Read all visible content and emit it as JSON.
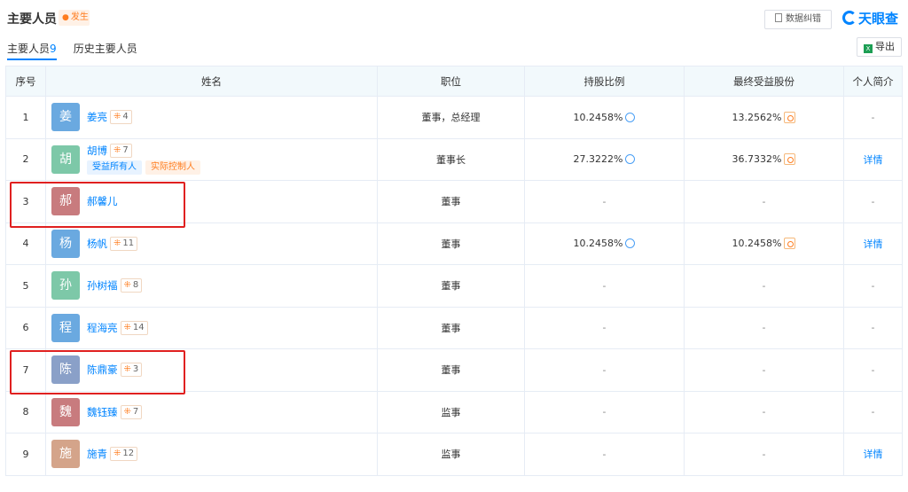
{
  "header": {
    "title": "主要人员",
    "follow_label": "发生",
    "correct_label": "数据纠错",
    "logo_text": "天眼查"
  },
  "tabs": [
    {
      "label": "主要人员",
      "count": "9"
    },
    {
      "label": "历史主要人员",
      "count": ""
    }
  ],
  "export_label": "导出",
  "columns": [
    "序号",
    "姓名",
    "职位",
    "持股比例",
    "最终受益股份",
    "个人简介"
  ],
  "rows": [
    {
      "no": "1",
      "avatar": "姜",
      "color": "#6aa9e0",
      "name": "姜亮",
      "relations": "4",
      "tags": [],
      "position": "董事，总经理",
      "share": "10.2458%",
      "benefit": "13.2562%",
      "intro": "-"
    },
    {
      "no": "2",
      "avatar": "胡",
      "color": "#7dc8a8",
      "name": "胡博",
      "relations": "7",
      "tags": [
        "受益所有人",
        "实际控制人"
      ],
      "position": "董事长",
      "share": "27.3222%",
      "benefit": "36.7332%",
      "intro": "详情"
    },
    {
      "no": "3",
      "avatar": "郝",
      "color": "#c87b7e",
      "name": "郝馨儿",
      "relations": "",
      "tags": [],
      "position": "董事",
      "share": "-",
      "benefit": "-",
      "intro": "-"
    },
    {
      "no": "4",
      "avatar": "杨",
      "color": "#6aa9e0",
      "name": "杨帆",
      "relations": "11",
      "tags": [],
      "position": "董事",
      "share": "10.2458%",
      "benefit": "10.2458%",
      "intro": "详情"
    },
    {
      "no": "5",
      "avatar": "孙",
      "color": "#7dc8a8",
      "name": "孙树福",
      "relations": "8",
      "tags": [],
      "position": "董事",
      "share": "-",
      "benefit": "-",
      "intro": "-"
    },
    {
      "no": "6",
      "avatar": "程",
      "color": "#6aa9e0",
      "name": "程海亮",
      "relations": "14",
      "tags": [],
      "position": "董事",
      "share": "-",
      "benefit": "-",
      "intro": "-"
    },
    {
      "no": "7",
      "avatar": "陈",
      "color": "#8aa0c8",
      "name": "陈鼎豪",
      "relations": "3",
      "tags": [],
      "position": "董事",
      "share": "-",
      "benefit": "-",
      "intro": "-"
    },
    {
      "no": "8",
      "avatar": "魏",
      "color": "#c87b7e",
      "name": "魏钰臻",
      "relations": "7",
      "tags": [],
      "position": "监事",
      "share": "-",
      "benefit": "-",
      "intro": "-"
    },
    {
      "no": "9",
      "avatar": "施",
      "color": "#d4a48a",
      "name": "施青",
      "relations": "12",
      "tags": [],
      "position": "监事",
      "share": "-",
      "benefit": "-",
      "intro": "详情"
    }
  ]
}
